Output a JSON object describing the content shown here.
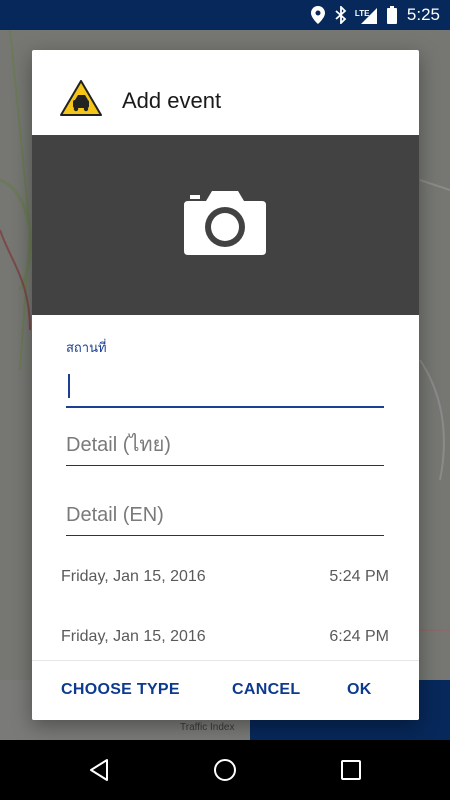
{
  "status_bar": {
    "time": "5:25",
    "network_label": "LTE",
    "icons": [
      "location-icon",
      "bluetooth-icon",
      "signal-icon",
      "battery-icon"
    ]
  },
  "dialog": {
    "title": "Add event",
    "title_icon": "traffic-accident-icon",
    "photo_icon": "camera-icon",
    "location_field": {
      "label": "สถานที่",
      "value": ""
    },
    "detail_th_field": {
      "placeholder": "Detail (ไทย)",
      "value": ""
    },
    "detail_en_field": {
      "placeholder": "Detail (EN)",
      "value": ""
    },
    "start": {
      "date": "Friday, Jan 15, 2016",
      "time": "5:24 PM"
    },
    "end": {
      "date": "Friday, Jan 15, 2016",
      "time": "6:24 PM"
    },
    "buttons": {
      "choose_type": "CHOOSE TYPE",
      "cancel": "CANCEL",
      "ok": "OK"
    }
  },
  "background": {
    "traffic_index_label": "Traffic Index"
  },
  "nav_bar": {
    "icons": [
      "back-icon",
      "home-icon",
      "recents-icon"
    ]
  },
  "colors": {
    "status_bar": "#07285a",
    "accent": "#1b3f94",
    "button_text": "#0d3a8e",
    "photo_area": "#424242"
  }
}
